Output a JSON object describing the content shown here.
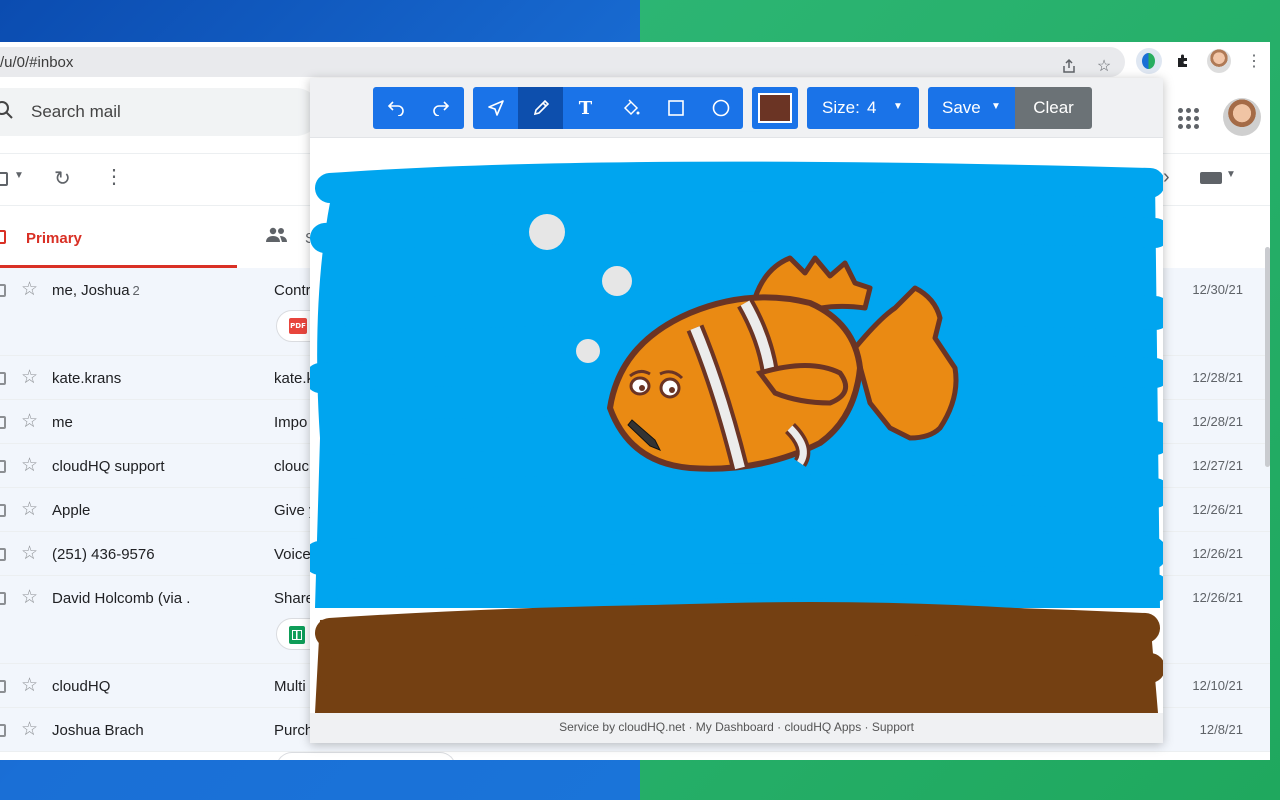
{
  "browser": {
    "url": "/u/0/#inbox",
    "toolbar_icons": [
      "share-icon",
      "bookmark-star-icon",
      "cloudhq-extension-icon",
      "puzzle-icon",
      "profile-avatar",
      "kebab-menu-icon"
    ]
  },
  "gmail": {
    "search_placeholder": "Search mail",
    "tabs": {
      "primary": "Primary",
      "social_partial": "S"
    },
    "emails": [
      {
        "sender": "me, Joshua",
        "count": "2",
        "subject": "Contr",
        "date": "12/30/21",
        "attachment": "pdf"
      },
      {
        "sender": "kate.krans",
        "count": "",
        "subject": "kate.k",
        "date": "12/28/21",
        "attachment": ""
      },
      {
        "sender": "me",
        "count": "",
        "subject": "Impo",
        "date": "12/28/21",
        "attachment": ""
      },
      {
        "sender": "cloudHQ support",
        "count": "",
        "subject": "clouc",
        "date": "12/27/21",
        "attachment": ""
      },
      {
        "sender": "Apple",
        "count": "",
        "subject": "Give y",
        "date": "12/26/21",
        "attachment": ""
      },
      {
        "sender": "(251) 436-9576",
        "count": "",
        "subject": "Voice",
        "date": "12/26/21",
        "attachment": ""
      },
      {
        "sender": "David Holcomb (via .",
        "count": "",
        "subject": "Share",
        "date": "12/26/21",
        "attachment": "sheet"
      },
      {
        "sender": "cloudHQ",
        "count": "",
        "subject": "Multi",
        "date": "12/10/21",
        "attachment": ""
      },
      {
        "sender": "Joshua Brach",
        "count": "",
        "subject": "Purch",
        "date": "12/8/21",
        "attachment": ""
      }
    ]
  },
  "drawing": {
    "tools": {
      "undo": "undo-icon",
      "redo": "redo-icon",
      "select": "pointer-icon",
      "pencil": "pencil-icon",
      "text": "T",
      "fill": "paint-bucket-icon",
      "rectangle": "rectangle-icon",
      "circle": "circle-icon"
    },
    "active_tool": "pencil",
    "current_color": "#6b3424",
    "size_label": "Size:",
    "size_value": "4",
    "save_label": "Save",
    "clear_label": "Clear",
    "footer": "Service by cloudHQ.net · My Dashboard · cloudHQ Apps · Support",
    "colors": {
      "water": "#00a5ef",
      "sand": "#744012",
      "fish": "#ea8a13",
      "outline": "#6b3424",
      "stripe": "#ececec",
      "bubble": "#e6e6e6"
    }
  }
}
